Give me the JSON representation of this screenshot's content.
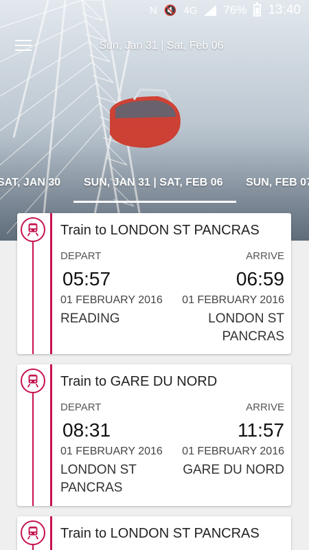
{
  "status_bar": {
    "network": "4G",
    "battery": "76%",
    "time": "13:40"
  },
  "header": {
    "title": "Sun, Jan 31 | Sat, Feb 06"
  },
  "tabs": {
    "prev": "SAT, JAN 30",
    "current": "SUN, JAN 31 | SAT, FEB 06",
    "next": "SUN, FEB 07"
  },
  "labels": {
    "depart": "DEPART",
    "arrive": "ARRIVE"
  },
  "trips": [
    {
      "title": "Train to LONDON ST PANCRAS",
      "depart_time": "05:57",
      "arrive_time": "06:59",
      "depart_date": "01 FEBRUARY 2016",
      "arrive_date": "01 FEBRUARY 2016",
      "from": "READING",
      "to": "LONDON ST PANCRAS"
    },
    {
      "title": "Train to GARE DU NORD",
      "depart_time": "08:31",
      "arrive_time": "11:57",
      "depart_date": "01 FEBRUARY 2016",
      "arrive_date": "01 FEBRUARY 2016",
      "from": "LONDON ST PANCRAS",
      "to": "GARE DU NORD"
    },
    {
      "title": "Train to LONDON ST PANCRAS"
    }
  ],
  "colors": {
    "accent": "#c5124f"
  },
  "icons": {
    "menu": "hamburger-menu-icon",
    "train": "train-icon"
  }
}
